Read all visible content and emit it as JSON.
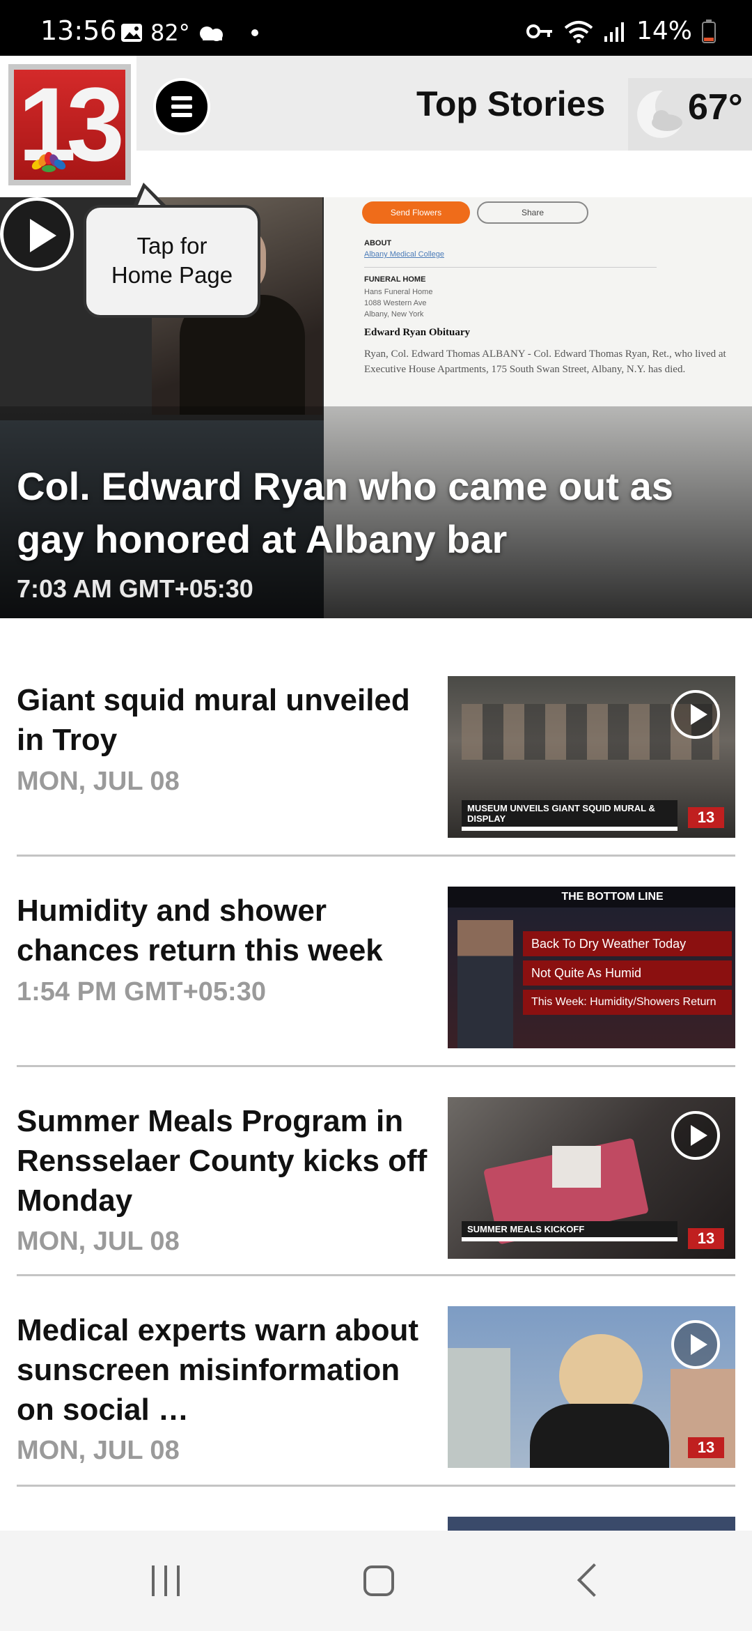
{
  "status_bar": {
    "time": "13:56",
    "weather_temp": "82°",
    "battery": "14%"
  },
  "header": {
    "logo_text": "13",
    "title": "Top Stories",
    "weather_temp": "67°"
  },
  "tooltip": {
    "line1": "Tap for",
    "line2": "Home Page"
  },
  "hero": {
    "title": "Col. Edward Ryan who came out as gay honored at Albany bar",
    "time": "7:03 AM GMT+05:30",
    "image_text": {
      "send_flowers": "Send Flowers",
      "share": "Share",
      "about_label": "ABOUT",
      "about_value": "Albany Medical College",
      "funeral_label": "FUNERAL HOME",
      "funeral_name": "Hans Funeral Home",
      "funeral_addr1": "1088 Western Ave",
      "funeral_addr2": "Albany, New York",
      "obit_heading": "Edward Ryan Obituary",
      "obit_body": "Ryan, Col. Edward Thomas ALBANY - Col. Edward Thomas Ryan, Ret., who lived at Executive House Apartments, 175 South Swan Street, Albany, N.Y. has died."
    }
  },
  "stories": [
    {
      "title": "Giant squid mural unveiled in Troy",
      "date": "MON, JUL 08",
      "chyron": "MUSEUM UNVEILS GIANT SQUID MURAL & DISPLAY",
      "has_play": true
    },
    {
      "title": "Humidity and shower chances return this week",
      "date": "1:54 PM GMT+05:30",
      "panel_title": "THE BOTTOM LINE",
      "panel_items": [
        "Back To Dry Weather Today",
        "Not Quite As Humid",
        "This Week: Humidity/Showers Return"
      ],
      "has_play": false
    },
    {
      "title": "Summer Meals Program in Rensselaer County kicks off Monday",
      "date": "MON, JUL 08",
      "chyron": "SUMMER MEALS KICKOFF",
      "has_play": true
    },
    {
      "title": "Medical experts warn about sunscreen misinformation on social …",
      "date": "MON, JUL 08",
      "has_play": true
    }
  ],
  "colors": {
    "brand_red": "#c01f1f",
    "header_gray": "#ececec",
    "date_gray": "#9a9a9a"
  }
}
